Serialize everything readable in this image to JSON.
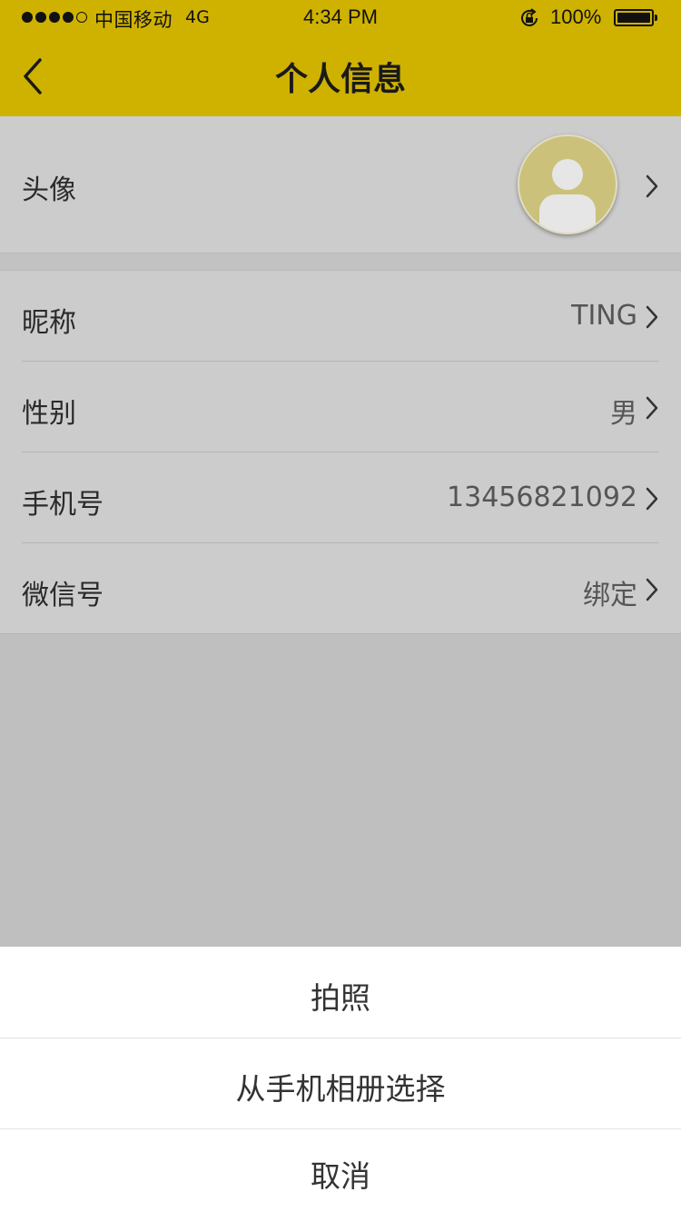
{
  "status_bar": {
    "carrier": "中国移动",
    "network": "4G",
    "time": "4:34 PM",
    "battery": "100%",
    "signal_bars": 4,
    "signal_max": 5
  },
  "nav": {
    "title": "个人信息",
    "back_icon": "chevron-left-icon"
  },
  "profile": {
    "avatar_label": "头像",
    "rows": [
      {
        "label": "昵称",
        "value": "TING"
      },
      {
        "label": "性别",
        "value": "男"
      },
      {
        "label": "手机号",
        "value": "13456821092"
      },
      {
        "label": "微信号",
        "value": "绑定"
      }
    ]
  },
  "action_sheet": {
    "take_photo": "拍照",
    "choose_album": "从手机相册选择",
    "cancel": "取消"
  },
  "colors": {
    "header": "#cfb200",
    "avatar_bg": "#cbc17b",
    "overlay": "#bfbfbf"
  }
}
